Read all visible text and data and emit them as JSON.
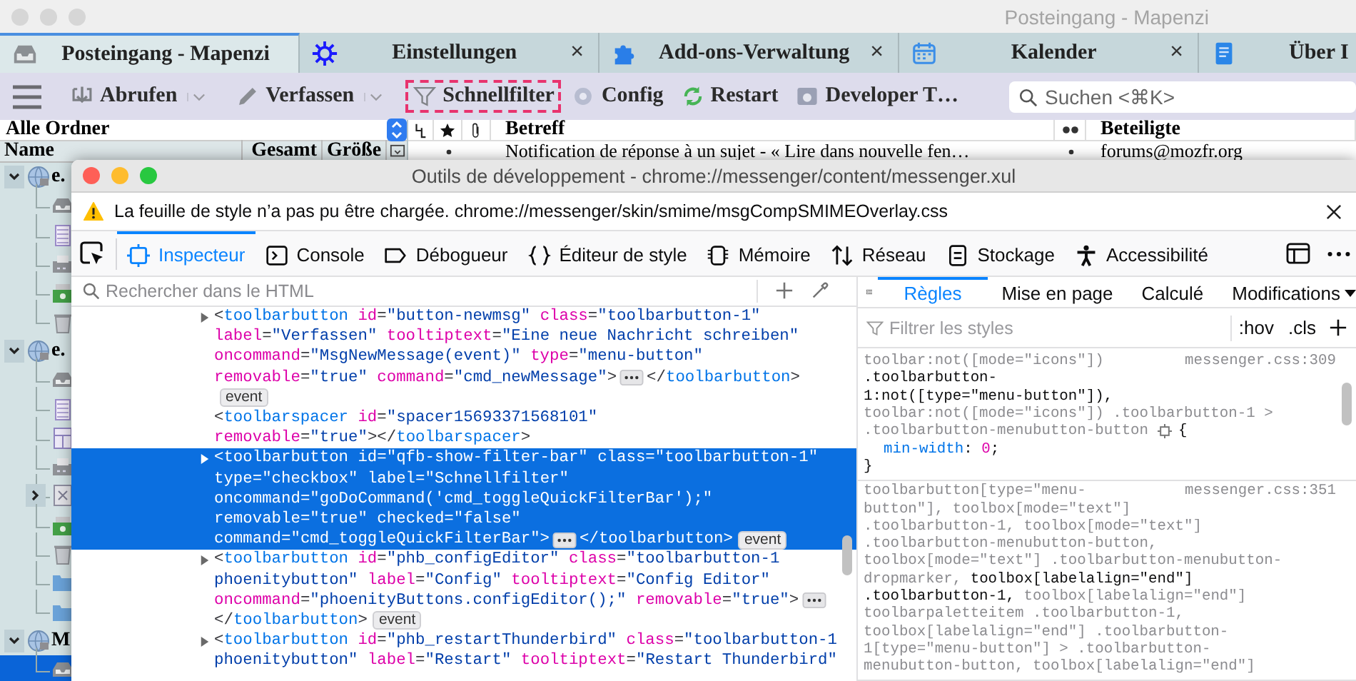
{
  "window": {
    "title": "Posteingang - Mapenzi"
  },
  "tabs": [
    {
      "kind": "mail",
      "label": "Posteingang - Mapenzi",
      "selected": true
    },
    {
      "kind": "settings",
      "label": "Einstellungen",
      "selected": false,
      "close": "×"
    },
    {
      "kind": "addons",
      "label": "Add-ons-Verwaltung",
      "selected": false,
      "close": "×"
    },
    {
      "kind": "calendar",
      "label": "Kalender",
      "selected": false,
      "close": "×"
    },
    {
      "kind": "page",
      "label": "Über I",
      "selected": false
    }
  ],
  "toolbar": {
    "items": [
      {
        "kind": "get",
        "label": "Abrufen",
        "dropdown": true,
        "highlighted": false
      },
      {
        "kind": "write",
        "label": "Verfassen",
        "dropdown": true,
        "highlighted": false
      },
      {
        "kind": "filter",
        "label": "Schnellfilter",
        "dropdown": false,
        "highlighted": true
      },
      {
        "kind": "config",
        "label": "Config",
        "dropdown": false,
        "highlighted": false
      },
      {
        "kind": "restart",
        "label": "Restart",
        "dropdown": false,
        "highlighted": false
      },
      {
        "kind": "devtools",
        "label": "Developer T…",
        "dropdown": false,
        "highlighted": false
      }
    ],
    "search": {
      "placeholder": "Suchen <⌘K>"
    }
  },
  "folder_pane": {
    "header": "Alle Ordner",
    "columns": [
      "Name",
      "Gesamt",
      "Größe"
    ],
    "tree": [
      {
        "kind": "account",
        "label": "e.",
        "expanded": true,
        "selected": false,
        "children": [
          {
            "kind": "inbox",
            "selected": false
          },
          {
            "kind": "drafts",
            "selected": false
          },
          {
            "kind": "outbox",
            "selected": false
          },
          {
            "kind": "junk",
            "selected": false
          },
          {
            "kind": "trash",
            "selected": false
          }
        ]
      },
      {
        "kind": "account",
        "label": "e.",
        "expanded": true,
        "selected": false,
        "children": [
          {
            "kind": "inbox",
            "selected": false
          },
          {
            "kind": "drafts",
            "selected": false
          },
          {
            "kind": "templates",
            "selected": false
          },
          {
            "kind": "outbox",
            "selected": false
          },
          {
            "kind": "archives",
            "selected": false,
            "expanded": false
          },
          {
            "kind": "junk",
            "selected": false
          },
          {
            "kind": "trash",
            "selected": false
          },
          {
            "kind": "folder",
            "selected": false
          },
          {
            "kind": "folder",
            "selected": false
          }
        ]
      },
      {
        "kind": "account",
        "label": "M",
        "expanded": true,
        "selected": false,
        "children": [
          {
            "kind": "inbox",
            "selected": true
          }
        ]
      }
    ]
  },
  "message_list": {
    "columns": [
      {
        "kind": "thread"
      },
      {
        "kind": "star"
      },
      {
        "kind": "attachment"
      },
      {
        "kind": "text",
        "label": "Betreff"
      },
      {
        "kind": "read"
      },
      {
        "kind": "text",
        "label": "Beteiligte"
      }
    ],
    "rows": [
      {
        "subject": "Notification de réponse à un sujet - « Lire dans nouvelle fen…",
        "correspondent": "forums@mozfr.org"
      }
    ]
  },
  "devtools": {
    "title": "Outils de développement - chrome://messenger/content/messenger.xul",
    "warning": "La feuille de style n’a pas pu être chargée. chrome://messenger/skin/smime/msgCompSMIMEOverlay.css",
    "tools": [
      {
        "kind": "inspector",
        "label": "Inspecteur",
        "selected": true
      },
      {
        "kind": "console",
        "label": "Console",
        "selected": false
      },
      {
        "kind": "debugger",
        "label": "Débogueur",
        "selected": false
      },
      {
        "kind": "style",
        "label": "Éditeur de style",
        "selected": false
      },
      {
        "kind": "memory",
        "label": "Mémoire",
        "selected": false
      },
      {
        "kind": "network",
        "label": "Réseau",
        "selected": false
      },
      {
        "kind": "storage",
        "label": "Stockage",
        "selected": false
      },
      {
        "kind": "accessibility",
        "label": "Accessibilité",
        "selected": false
      }
    ],
    "markup": {
      "search_placeholder": "Rechercher dans le HTML",
      "nodes": [
        {
          "expandable": true,
          "selected": false,
          "lines": [
            [
              {
                "kind": "code",
                "text": "<toolbarbutton id=\"button-newmsg\" class=\"toolbarbutton-1\""
              }
            ],
            [
              {
                "kind": "code",
                "text": "label=\"Verfassen\" tooltiptext=\"Eine neue Nachricht schreiben\""
              }
            ],
            [
              {
                "kind": "code",
                "text": "oncommand=\"MsgNewMessage(event)\" type=\"menu-button\""
              }
            ],
            [
              {
                "kind": "code",
                "text": "removable=\"true\" command=\"cmd_newMessage\">"
              },
              {
                "kind": "more"
              },
              {
                "kind": "code",
                "text": "</toolbarbutton>"
              }
            ],
            [
              {
                "kind": "badge",
                "text": "event"
              }
            ]
          ]
        },
        {
          "expandable": false,
          "selected": false,
          "lines": [
            [
              {
                "kind": "code",
                "text": "<toolbarspacer id=\"spacer15693371568101\""
              }
            ],
            [
              {
                "kind": "code",
                "text": "removable=\"true\"></toolbarspacer>"
              }
            ]
          ]
        },
        {
          "expandable": true,
          "selected": true,
          "lines": [
            [
              {
                "kind": "code",
                "text": "<toolbarbutton id=\"qfb-show-filter-bar\" class=\"toolbarbutton-1\""
              }
            ],
            [
              {
                "kind": "code",
                "text": "type=\"checkbox\" label=\"Schnellfilter\""
              }
            ],
            [
              {
                "kind": "code",
                "text": "oncommand=\"goDoCommand('cmd_toggleQuickFilterBar');\""
              }
            ],
            [
              {
                "kind": "code",
                "text": "removable=\"true\" checked=\"false\""
              }
            ],
            [
              {
                "kind": "code",
                "text": "command=\"cmd_toggleQuickFilterBar\">"
              },
              {
                "kind": "more"
              },
              {
                "kind": "code",
                "text": "</toolbarbutton>"
              },
              {
                "kind": "badge",
                "text": "event"
              }
            ]
          ]
        },
        {
          "expandable": true,
          "selected": false,
          "lines": [
            [
              {
                "kind": "code",
                "text": "<toolbarbutton id=\"phb_configEditor\" class=\"toolbarbutton-1"
              }
            ],
            [
              {
                "kind": "code",
                "text": "phoenitybutton\" label=\"Config\" tooltiptext=\"Config Editor\""
              }
            ],
            [
              {
                "kind": "code",
                "text": "oncommand=\"phoenityButtons.configEditor();\" removable=\"true\">"
              },
              {
                "kind": "more"
              }
            ],
            [
              {
                "kind": "code",
                "text": "</toolbarbutton>"
              },
              {
                "kind": "badge",
                "text": "event"
              }
            ]
          ]
        },
        {
          "expandable": true,
          "selected": false,
          "lines": [
            [
              {
                "kind": "code",
                "text": "<toolbarbutton id=\"phb_restartThunderbird\" class=\"toolbarbutton-1"
              }
            ],
            [
              {
                "kind": "code",
                "text": "phoenitybutton\" label=\"Restart\" tooltiptext=\"Restart Thunderbird\""
              }
            ]
          ]
        }
      ]
    },
    "sidebar": {
      "tabs": [
        {
          "label": "Règles",
          "selected": true
        },
        {
          "label": "Mise en page",
          "selected": false
        },
        {
          "label": "Calculé",
          "selected": false
        },
        {
          "label": "Modifications",
          "selected": false,
          "dropdown": true
        }
      ],
      "filter_placeholder": "Filtrer les styles",
      "hov": ":hov",
      "cls": ".cls",
      "rules": [
        {
          "source": "messenger.css:309",
          "open": "{",
          "close": "}",
          "selector_lines": [
            [
              {
                "text": "toolbar:not([mode=\"icons\"])",
                "matched": false
              }
            ],
            [
              {
                "text": ".toolbarbutton-",
                "matched": true
              }
            ],
            [
              {
                "text": "1:not([type=\"menu-button\"]),",
                "matched": true
              }
            ],
            [
              {
                "text": "toolbar:not([mode=\"icons\"]) .toolbarbutton-1 >",
                "matched": false
              }
            ],
            [
              {
                "text": ".toolbarbutton-menubutton-button",
                "matched": false
              }
            ]
          ],
          "declarations": [
            {
              "property": "min-width",
              "colon": ":",
              "value": "0",
              "semicolon": ";"
            }
          ]
        },
        {
          "source": "messenger.css:351",
          "selector_lines": [
            [
              {
                "text": "toolbarbutton[type=\"menu-",
                "matched": false
              }
            ],
            [
              {
                "text": "button\"], toolbox[mode=\"text\"]",
                "matched": false
              }
            ],
            [
              {
                "text": ".toolbarbutton-1, toolbox[mode=\"text\"]",
                "matched": false
              }
            ],
            [
              {
                "text": ".toolbarbutton-menubutton-button,",
                "matched": false
              }
            ],
            [
              {
                "text": "toolbox[mode=\"text\"] .toolbarbutton-menubutton-",
                "matched": false
              }
            ],
            [
              {
                "text": "dropmarker, ",
                "matched": false
              },
              {
                "text": "toolbox[labelalign=\"end\"]",
                "matched": true
              }
            ],
            [
              {
                "text": ".toolbarbutton-1,",
                "matched": true
              },
              {
                "text": " toolbox[labelalign=\"end\"]",
                "matched": false
              }
            ],
            [
              {
                "text": "toolbarpaletteitem .toolbarbutton-1,",
                "matched": false
              }
            ],
            [
              {
                "text": "toolbox[labelalign=\"end\"] .toolbarbutton-",
                "matched": false
              }
            ],
            [
              {
                "text": "1[type=\"menu-button\"] > .toolbarbutton-",
                "matched": false
              }
            ],
            [
              {
                "text": "menubutton-button, toolbox[labelalign=\"end\"]",
                "matched": false
              }
            ]
          ]
        }
      ]
    }
  }
}
